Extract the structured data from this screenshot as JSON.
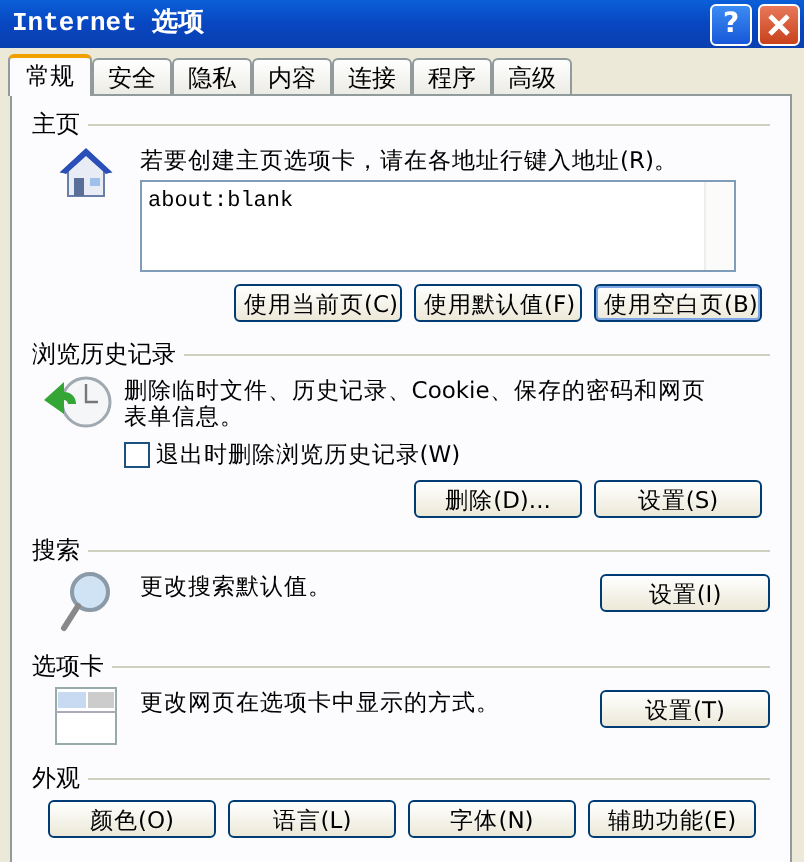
{
  "window": {
    "title": "Internet 选项",
    "help_button": "?"
  },
  "tabs": [
    {
      "label": "常规",
      "selected": true
    },
    {
      "label": "安全",
      "selected": false
    },
    {
      "label": "隐私",
      "selected": false
    },
    {
      "label": "内容",
      "selected": false
    },
    {
      "label": "连接",
      "selected": false
    },
    {
      "label": "程序",
      "selected": false
    },
    {
      "label": "高级",
      "selected": false
    }
  ],
  "sections": [
    {
      "kind": "home",
      "title": "主页",
      "description": "若要创建主页选项卡，请在各地址行键入地址(R)。",
      "address": "about:blank",
      "buttons": [
        {
          "label": "使用当前页(C)",
          "focused": false
        },
        {
          "label": "使用默认值(F)",
          "focused": false
        },
        {
          "label": "使用空白页(B)",
          "focused": true
        }
      ]
    },
    {
      "kind": "history",
      "title": "浏览历史记录",
      "description": "删除临时文件、历史记录、Cookie、保存的密码和网页表单信息。",
      "checkbox": {
        "label": "退出时删除浏览历史记录(W)",
        "checked": false
      },
      "buttons": [
        {
          "label": "删除(D)...",
          "focused": false
        },
        {
          "label": "设置(S)",
          "focused": false
        }
      ]
    },
    {
      "kind": "search",
      "title": "搜索",
      "description": "更改搜索默认值。",
      "buttons": [
        {
          "label": "设置(I)",
          "focused": false
        }
      ]
    },
    {
      "kind": "tabs",
      "title": "选项卡",
      "description": "更改网页在选项卡中显示的方式。",
      "buttons": [
        {
          "label": "设置(T)",
          "focused": false
        }
      ]
    },
    {
      "kind": "appearance",
      "title": "外观",
      "buttons": [
        {
          "label": "颜色(O)",
          "focused": false
        },
        {
          "label": "语言(L)",
          "focused": false
        },
        {
          "label": "字体(N)",
          "focused": false
        },
        {
          "label": "辅助功能(E)",
          "focused": false
        }
      ]
    }
  ]
}
